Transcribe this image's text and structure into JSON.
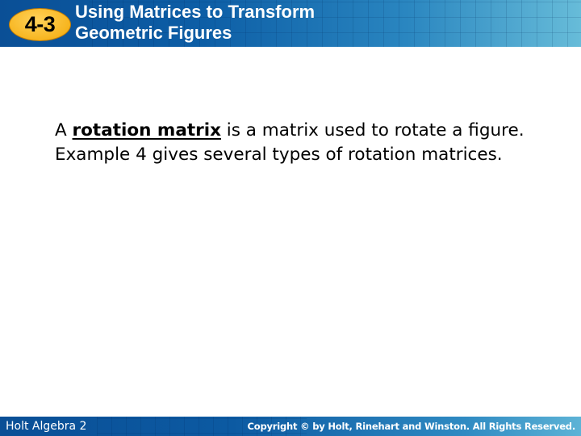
{
  "header": {
    "lesson_number": "4-3",
    "title_line1": "Using Matrices to Transform",
    "title_line2": "Geometric Figures",
    "colors": {
      "banner_start": "#0a4f96",
      "banner_end": "#67bcd9",
      "badge": "#f7b51f"
    }
  },
  "content": {
    "intro": "A ",
    "term": "rotation matrix",
    "rest": " is a matrix used to rotate a figure. Example 4 gives several types of rotation matrices."
  },
  "footer": {
    "book": "Holt Algebra 2",
    "copyright": "Copyright © by Holt, Rinehart and Winston. All Rights Reserved."
  }
}
